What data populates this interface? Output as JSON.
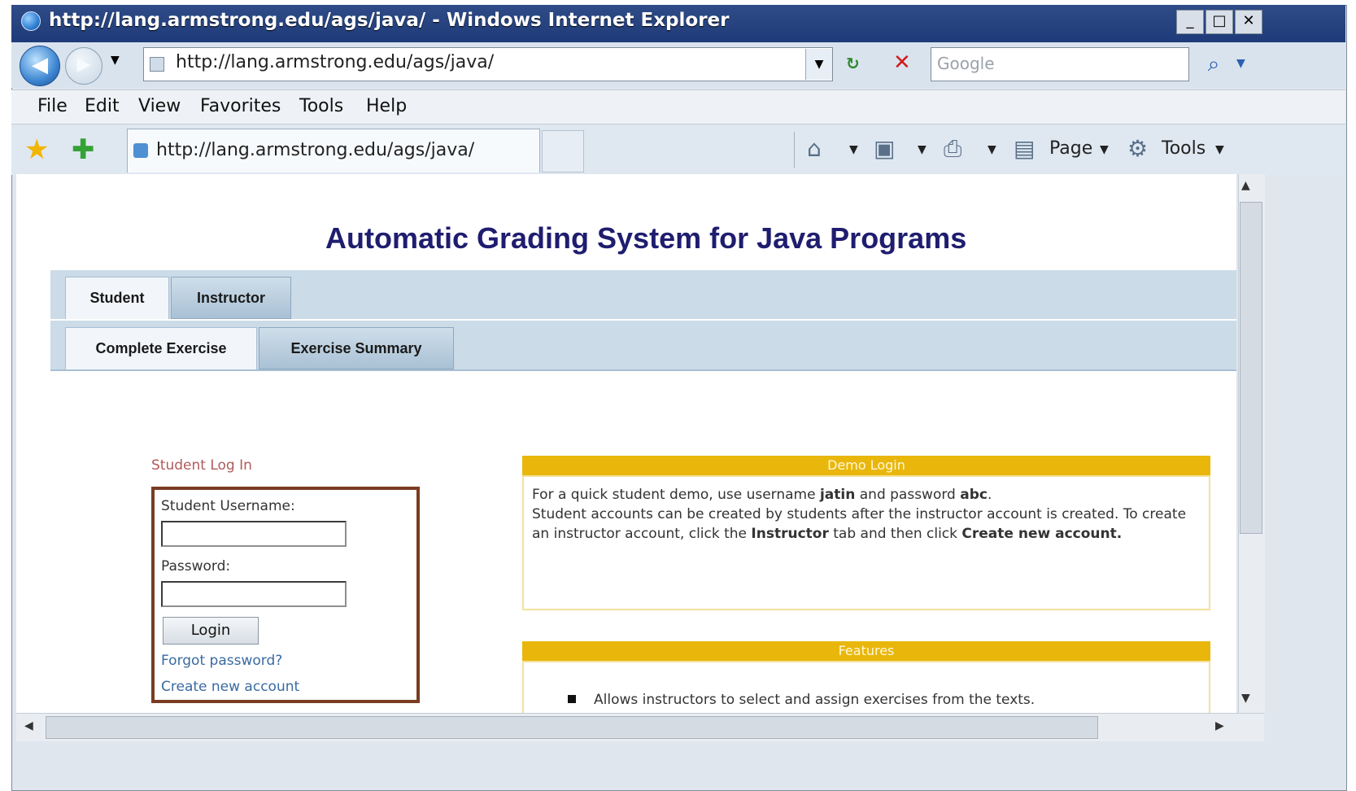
{
  "window": {
    "title": "http://lang.armstrong.edu/ags/java/ - Windows Internet Explorer",
    "minimize": "_",
    "maximize": "□",
    "close": "✕"
  },
  "browser": {
    "address": "http://lang.armstrong.edu/ags/java/",
    "search_placeholder": "Google",
    "menu": [
      "File",
      "Edit",
      "View",
      "Favorites",
      "Tools",
      "Help"
    ],
    "tab_title": "http://lang.armstrong.edu/ags/java/",
    "command_bar": {
      "page_label": "Page",
      "tools_label": "Tools"
    }
  },
  "page": {
    "title": "Automatic Grading System for Java Programs",
    "primary_tabs": [
      {
        "label": "Student",
        "active": true
      },
      {
        "label": "Instructor",
        "active": false
      }
    ],
    "secondary_tabs": [
      {
        "label": "Complete Exercise",
        "active": true
      },
      {
        "label": "Exercise Summary",
        "active": false
      }
    ],
    "login": {
      "heading": "Student Log In",
      "username_label": "Student Username:",
      "password_label": "Password:",
      "button": "Login",
      "forgot": "Forgot password?",
      "create": "Create new account"
    },
    "demo": {
      "title": "Demo Login",
      "line1_prefix": "For a quick student demo, use username ",
      "username": "jatin",
      "line1_mid": " and password ",
      "password": "abc",
      "line1_end": ".",
      "line2_prefix": "Student accounts can be created by students after the instructor account is created. To create an instructor account, click the ",
      "instructor": "Instructor",
      "line2_mid": " tab and then click ",
      "create_account": "Create new account."
    },
    "features": {
      "title": "Features",
      "items": [
        "Allows instructors to select and assign exercises from the texts."
      ]
    }
  }
}
